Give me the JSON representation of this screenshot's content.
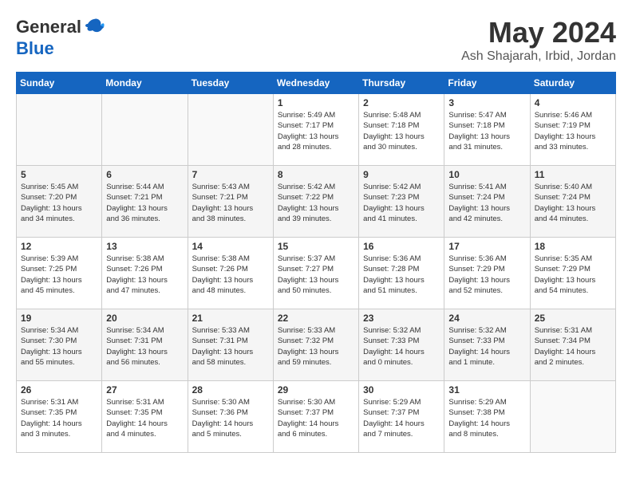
{
  "logo": {
    "general": "General",
    "blue": "Blue"
  },
  "title": {
    "month": "May 2024",
    "location": "Ash Shajarah, Irbid, Jordan"
  },
  "weekdays": [
    "Sunday",
    "Monday",
    "Tuesday",
    "Wednesday",
    "Thursday",
    "Friday",
    "Saturday"
  ],
  "weeks": [
    [
      {
        "day": "",
        "info": ""
      },
      {
        "day": "",
        "info": ""
      },
      {
        "day": "",
        "info": ""
      },
      {
        "day": "1",
        "info": "Sunrise: 5:49 AM\nSunset: 7:17 PM\nDaylight: 13 hours\nand 28 minutes."
      },
      {
        "day": "2",
        "info": "Sunrise: 5:48 AM\nSunset: 7:18 PM\nDaylight: 13 hours\nand 30 minutes."
      },
      {
        "day": "3",
        "info": "Sunrise: 5:47 AM\nSunset: 7:18 PM\nDaylight: 13 hours\nand 31 minutes."
      },
      {
        "day": "4",
        "info": "Sunrise: 5:46 AM\nSunset: 7:19 PM\nDaylight: 13 hours\nand 33 minutes."
      }
    ],
    [
      {
        "day": "5",
        "info": "Sunrise: 5:45 AM\nSunset: 7:20 PM\nDaylight: 13 hours\nand 34 minutes."
      },
      {
        "day": "6",
        "info": "Sunrise: 5:44 AM\nSunset: 7:21 PM\nDaylight: 13 hours\nand 36 minutes."
      },
      {
        "day": "7",
        "info": "Sunrise: 5:43 AM\nSunset: 7:21 PM\nDaylight: 13 hours\nand 38 minutes."
      },
      {
        "day": "8",
        "info": "Sunrise: 5:42 AM\nSunset: 7:22 PM\nDaylight: 13 hours\nand 39 minutes."
      },
      {
        "day": "9",
        "info": "Sunrise: 5:42 AM\nSunset: 7:23 PM\nDaylight: 13 hours\nand 41 minutes."
      },
      {
        "day": "10",
        "info": "Sunrise: 5:41 AM\nSunset: 7:24 PM\nDaylight: 13 hours\nand 42 minutes."
      },
      {
        "day": "11",
        "info": "Sunrise: 5:40 AM\nSunset: 7:24 PM\nDaylight: 13 hours\nand 44 minutes."
      }
    ],
    [
      {
        "day": "12",
        "info": "Sunrise: 5:39 AM\nSunset: 7:25 PM\nDaylight: 13 hours\nand 45 minutes."
      },
      {
        "day": "13",
        "info": "Sunrise: 5:38 AM\nSunset: 7:26 PM\nDaylight: 13 hours\nand 47 minutes."
      },
      {
        "day": "14",
        "info": "Sunrise: 5:38 AM\nSunset: 7:26 PM\nDaylight: 13 hours\nand 48 minutes."
      },
      {
        "day": "15",
        "info": "Sunrise: 5:37 AM\nSunset: 7:27 PM\nDaylight: 13 hours\nand 50 minutes."
      },
      {
        "day": "16",
        "info": "Sunrise: 5:36 AM\nSunset: 7:28 PM\nDaylight: 13 hours\nand 51 minutes."
      },
      {
        "day": "17",
        "info": "Sunrise: 5:36 AM\nSunset: 7:29 PM\nDaylight: 13 hours\nand 52 minutes."
      },
      {
        "day": "18",
        "info": "Sunrise: 5:35 AM\nSunset: 7:29 PM\nDaylight: 13 hours\nand 54 minutes."
      }
    ],
    [
      {
        "day": "19",
        "info": "Sunrise: 5:34 AM\nSunset: 7:30 PM\nDaylight: 13 hours\nand 55 minutes."
      },
      {
        "day": "20",
        "info": "Sunrise: 5:34 AM\nSunset: 7:31 PM\nDaylight: 13 hours\nand 56 minutes."
      },
      {
        "day": "21",
        "info": "Sunrise: 5:33 AM\nSunset: 7:31 PM\nDaylight: 13 hours\nand 58 minutes."
      },
      {
        "day": "22",
        "info": "Sunrise: 5:33 AM\nSunset: 7:32 PM\nDaylight: 13 hours\nand 59 minutes."
      },
      {
        "day": "23",
        "info": "Sunrise: 5:32 AM\nSunset: 7:33 PM\nDaylight: 14 hours\nand 0 minutes."
      },
      {
        "day": "24",
        "info": "Sunrise: 5:32 AM\nSunset: 7:33 PM\nDaylight: 14 hours\nand 1 minute."
      },
      {
        "day": "25",
        "info": "Sunrise: 5:31 AM\nSunset: 7:34 PM\nDaylight: 14 hours\nand 2 minutes."
      }
    ],
    [
      {
        "day": "26",
        "info": "Sunrise: 5:31 AM\nSunset: 7:35 PM\nDaylight: 14 hours\nand 3 minutes."
      },
      {
        "day": "27",
        "info": "Sunrise: 5:31 AM\nSunset: 7:35 PM\nDaylight: 14 hours\nand 4 minutes."
      },
      {
        "day": "28",
        "info": "Sunrise: 5:30 AM\nSunset: 7:36 PM\nDaylight: 14 hours\nand 5 minutes."
      },
      {
        "day": "29",
        "info": "Sunrise: 5:30 AM\nSunset: 7:37 PM\nDaylight: 14 hours\nand 6 minutes."
      },
      {
        "day": "30",
        "info": "Sunrise: 5:29 AM\nSunset: 7:37 PM\nDaylight: 14 hours\nand 7 minutes."
      },
      {
        "day": "31",
        "info": "Sunrise: 5:29 AM\nSunset: 7:38 PM\nDaylight: 14 hours\nand 8 minutes."
      },
      {
        "day": "",
        "info": ""
      }
    ]
  ]
}
